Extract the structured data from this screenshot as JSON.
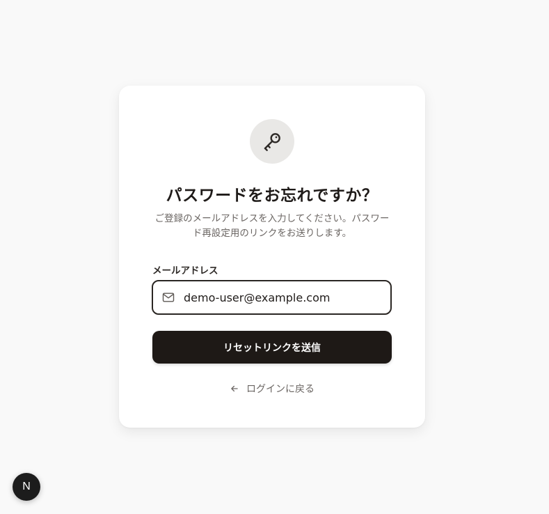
{
  "card": {
    "title": "パスワードをお忘れですか？",
    "subtitle": "ご登録のメールアドレスを入力してください。パスワード再設定用のリンクをお送りします。",
    "icon": "key-icon"
  },
  "form": {
    "email_label": "メールアドレス",
    "email_value": "demo-user@example.com",
    "email_icon": "mail-icon",
    "submit_label": "リセットリンクを送信"
  },
  "footer": {
    "back_label": "ログインに戻る",
    "back_icon": "arrow-left-icon"
  },
  "dev_badge": {
    "label": "N"
  },
  "colors": {
    "background": "#f9f9f9",
    "card": "#ffffff",
    "primary": "#1e1916",
    "muted_text": "#6b6663",
    "icon_badge": "#e9e8e6"
  }
}
